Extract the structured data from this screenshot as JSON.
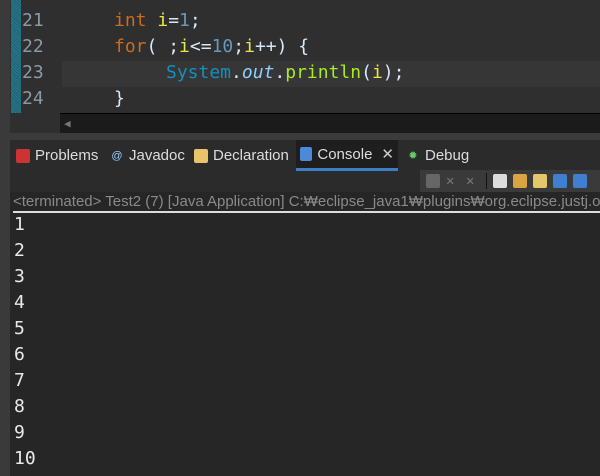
{
  "editor": {
    "lines": [
      {
        "num": "21",
        "tokens": [
          {
            "t": "int ",
            "c": "kw"
          },
          {
            "t": "i",
            "c": "var"
          },
          {
            "t": "=",
            "c": ""
          },
          {
            "t": "1",
            "c": "num"
          },
          {
            "t": ";",
            "c": ""
          }
        ],
        "indent": 8
      },
      {
        "num": "22",
        "tokens": [
          {
            "t": "for",
            "c": "kw"
          },
          {
            "t": "( ;",
            "c": ""
          },
          {
            "t": "i",
            "c": "var"
          },
          {
            "t": "<=",
            "c": ""
          },
          {
            "t": "10",
            "c": "num"
          },
          {
            "t": ";",
            "c": ""
          },
          {
            "t": "i",
            "c": "var"
          },
          {
            "t": "++) {",
            "c": ""
          }
        ],
        "indent": 8
      },
      {
        "num": "23",
        "tokens": [
          {
            "t": "System",
            "c": "cls"
          },
          {
            "t": ".",
            "c": ""
          },
          {
            "t": "out",
            "c": "fld"
          },
          {
            "t": ".",
            "c": ""
          },
          {
            "t": "println",
            "c": "mth"
          },
          {
            "t": "(",
            "c": ""
          },
          {
            "t": "i",
            "c": "var"
          },
          {
            "t": ");",
            "c": ""
          }
        ],
        "indent": 12
      },
      {
        "num": "24",
        "tokens": [
          {
            "t": "}",
            "c": ""
          }
        ],
        "indent": 8
      }
    ]
  },
  "tabs": [
    {
      "label": "Problems",
      "icon": "problems-icon"
    },
    {
      "label": "Javadoc",
      "icon": "javadoc-icon"
    },
    {
      "label": "Declaration",
      "icon": "declaration-icon"
    },
    {
      "label": "Console",
      "icon": "console-icon",
      "active": true
    },
    {
      "label": "Debug",
      "icon": "debug-icon"
    }
  ],
  "console": {
    "header": "<terminated> Test2 (7) [Java Application] C:₩eclipse_java1₩plugins₩org.eclipse.justj.o",
    "output": [
      "1",
      "2",
      "3",
      "4",
      "5",
      "6",
      "7",
      "8",
      "9",
      "10"
    ]
  }
}
